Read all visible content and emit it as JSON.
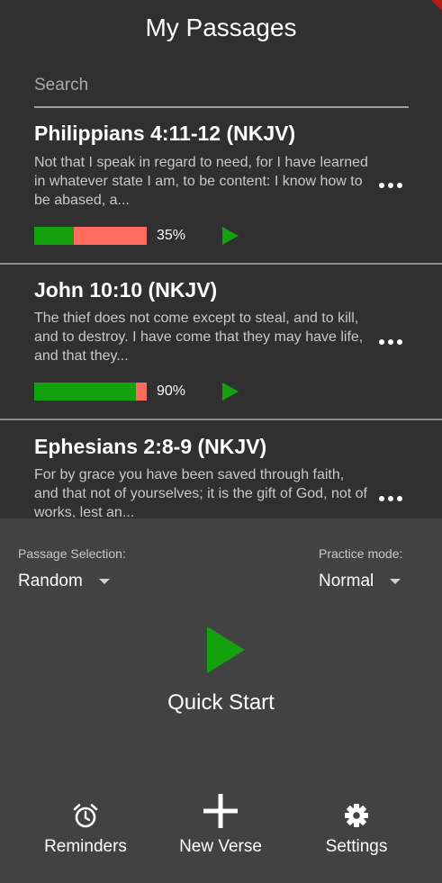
{
  "app": {
    "title": "My Passages"
  },
  "search": {
    "placeholder": "Search"
  },
  "passages": [
    {
      "title": "Philippians 4:11-12 (NKJV)",
      "excerpt": "Not that I speak in regard to need, for I have learned in whatever state I am, to be content: I know how to be abased, a...",
      "progress_percent": 35,
      "progress_label": "35%"
    },
    {
      "title": "John 10:10 (NKJV)",
      "excerpt": "The thief does not come except to steal, and to kill, and to destroy. I have come that they may have life, and that they...",
      "progress_percent": 90,
      "progress_label": "90%"
    },
    {
      "title": "Ephesians 2:8-9 (NKJV)",
      "excerpt": "For by grace you have been saved through faith, and that not of yourselves; it is the gift of God, not of works, lest an..."
    }
  ],
  "practice": {
    "selection_label": "Passage Selection:",
    "selection_value": "Random",
    "mode_label": "Practice mode:",
    "mode_value": "Normal",
    "quick_start_label": "Quick Start"
  },
  "nav": {
    "reminders": {
      "label": "Reminders",
      "icon": "alarm-icon"
    },
    "new_verse": {
      "label": "New Verse",
      "icon": "plus-icon"
    },
    "settings": {
      "label": "Settings",
      "icon": "gear-icon"
    }
  },
  "colors": {
    "background": "#303030",
    "panel": "#424242",
    "progress_done": "#13a10e",
    "progress_remaining": "#ff6b5e",
    "play": "#13a10e",
    "accent_corner": "#b71c1c"
  }
}
